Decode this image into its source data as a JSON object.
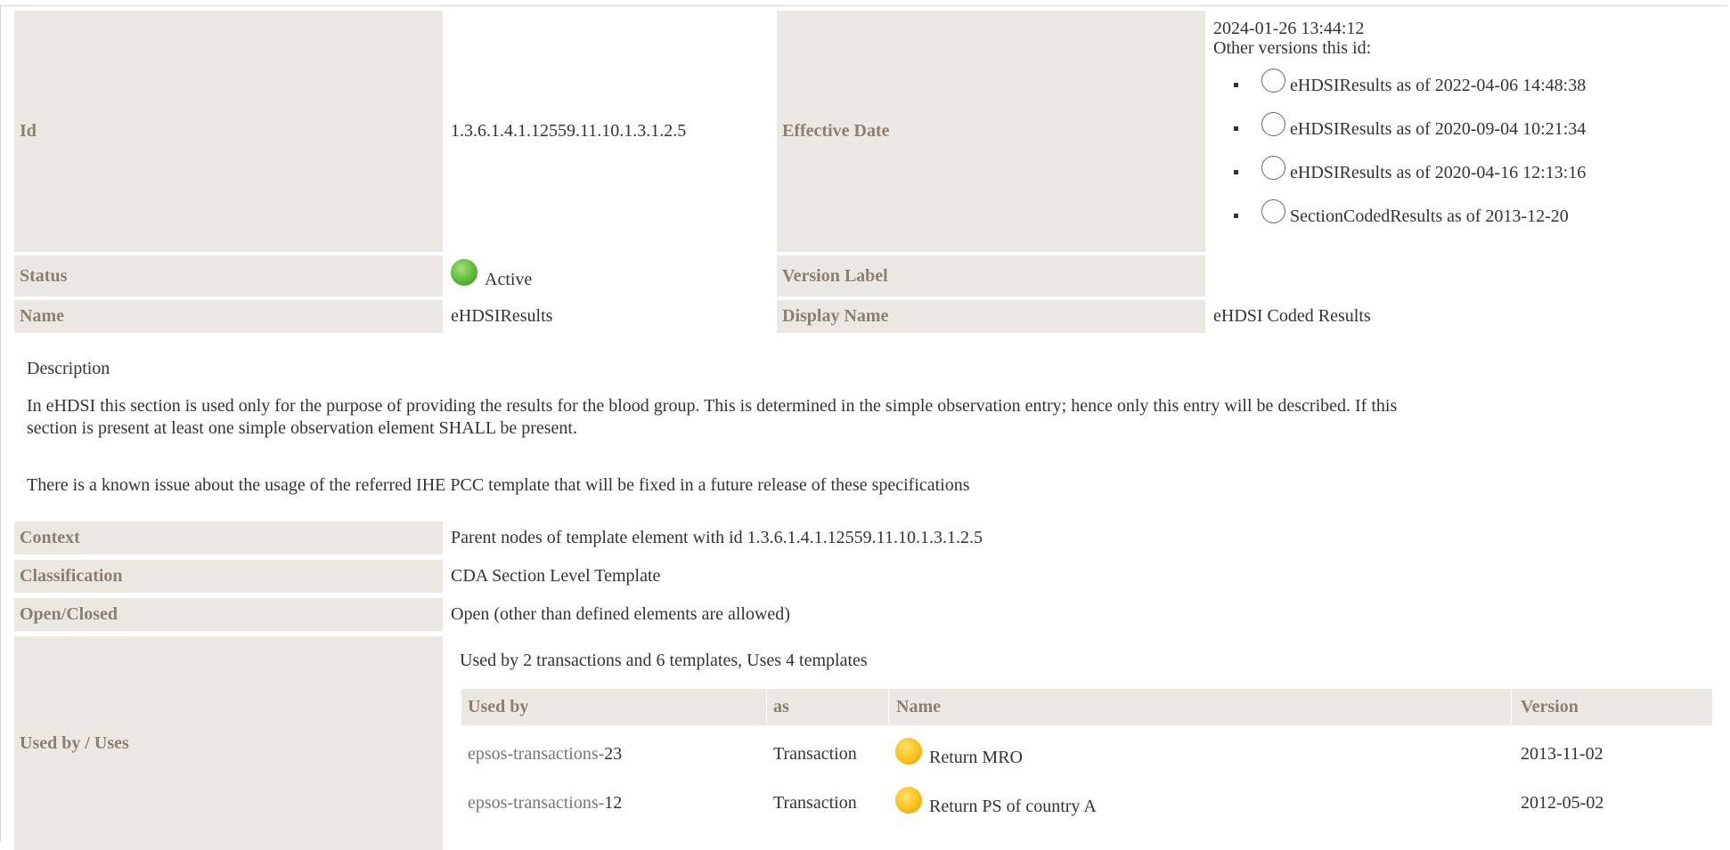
{
  "header": {
    "id_label": "Id",
    "id_value": "1.3.6.1.4.1.12559.11.10.1.3.1.2.5",
    "effective_date_label": "Effective Date",
    "effective_date_value": "2024-01-26 13:44:12",
    "other_versions_label": "Other versions this id:",
    "other_versions": [
      "eHDSIResults as of 2022-04-06 14:48:38",
      "eHDSIResults as of 2020-09-04 10:21:34",
      "eHDSIResults as of 2020-04-16 12:13:16",
      "SectionCodedResults as of 2013-12-20"
    ],
    "status_label": "Status",
    "status_value": "Active",
    "version_label_label": "Version Label",
    "version_label_value": "",
    "name_label": "Name",
    "name_value": "eHDSIResults",
    "display_name_label": "Display Name",
    "display_name_value": "eHDSI Coded Results"
  },
  "description": {
    "heading": "Description",
    "paragraph1_line1": "In eHDSI this section is used only for the purpose of providing the results for the blood group. This is determined in the simple observation entry; hence only this entry will be described. If this",
    "paragraph1_line2": "section is present at least one simple observation element SHALL be present.",
    "paragraph2": "There is a known issue about the usage of the referred IHE PCC template that will be fixed in a future release of these specifications"
  },
  "details": {
    "context_label": "Context",
    "context_value": "Parent nodes of template element with id 1.3.6.1.4.1.12559.11.10.1.3.1.2.5",
    "classification_label": "Classification",
    "classification_value": "CDA Section Level Template",
    "open_closed_label": "Open/Closed",
    "open_closed_value": "Open (other than defined elements are allowed)",
    "used_by_label": "Used by / Uses",
    "used_by_summary": "Used by 2 transactions and 6 templates, Uses 4 templates"
  },
  "usage_table": {
    "columns": [
      "Used by",
      "as",
      "Name",
      "Version"
    ],
    "rows": [
      {
        "link_prefix": "epsos-transactions-",
        "link_id": "23",
        "as": "Transaction",
        "name": "Return MRO",
        "version": "2013-11-02"
      },
      {
        "link_prefix": "epsos-transactions-",
        "link_id": "12",
        "as": "Transaction",
        "name": "Return PS of country A",
        "version": "2012-05-02"
      }
    ]
  },
  "colors": {
    "label_bg": "#ebe8e4",
    "label_text": "#8b7f72",
    "status_active": "#5cb83a",
    "status_draft": "#fbbf1a"
  }
}
